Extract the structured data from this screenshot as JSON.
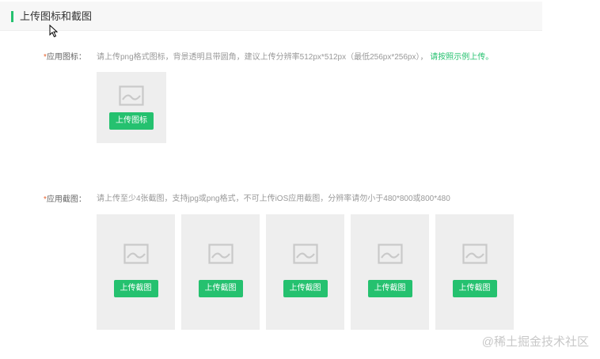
{
  "header": {
    "title": "上传图标和截图"
  },
  "icon_field": {
    "required_mark": "*",
    "label": "应用图标：",
    "hint": "请上传png格式图标，背景透明且带圆角，建议上传分辨率512px*512px（最低256px*256px）， ",
    "hint_link": "请按照示例上传。",
    "upload_button": "上传图标"
  },
  "screenshot_field": {
    "required_mark": "*",
    "label": "应用截图：",
    "hint": "请上传至少4张截图，支持jpg或png格式，不可上传iOS应用截图，分辨率请勿小于480*800或800*480",
    "slots": [
      {
        "upload_button": "上传截图"
      },
      {
        "upload_button": "上传截图"
      },
      {
        "upload_button": "上传截图"
      },
      {
        "upload_button": "上传截图"
      },
      {
        "upload_button": "上传截图"
      }
    ]
  },
  "watermark": "@稀土掘金技术社区",
  "colors": {
    "accent": "#25c16f",
    "required": "#e8612c",
    "placeholder_bg": "#eeeeee"
  },
  "icons": {
    "placeholder": "image-placeholder-icon",
    "cursor": "mouse-cursor-icon"
  }
}
